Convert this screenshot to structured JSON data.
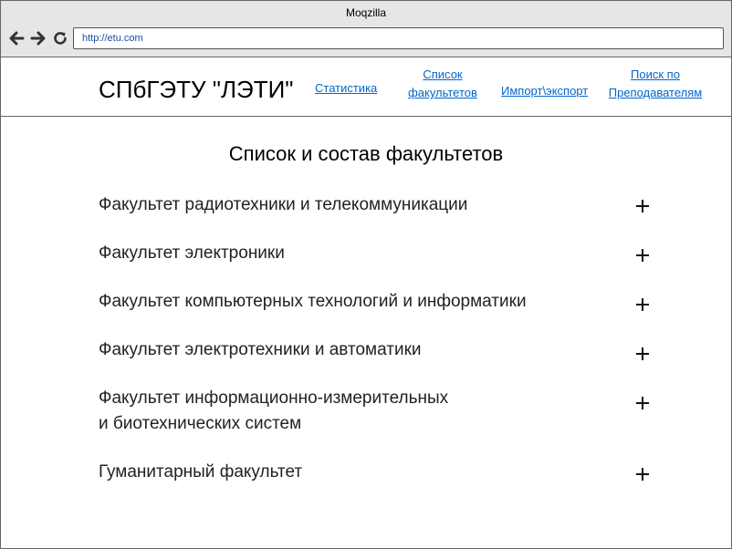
{
  "browser": {
    "window_title": "Moqzilla",
    "url": "http://etu.com",
    "back_icon": "back-arrow-icon",
    "forward_icon": "forward-arrow-icon",
    "reload_icon": "reload-icon"
  },
  "header": {
    "site_title": "СПбГЭТУ \"ЛЭТИ\"",
    "nav": [
      {
        "label": "Статистика"
      },
      {
        "label": "Список\nфакультетов"
      },
      {
        "label": "Импорт\\экспорт"
      },
      {
        "label": "Поиск по\nПреподавателям"
      }
    ]
  },
  "main": {
    "title": "Список и состав факультетов",
    "faculties": [
      {
        "label": "Факультет радиотехники и телекоммуникации",
        "icon": "plus-icon"
      },
      {
        "label": "Факультет электроники",
        "icon": "plus-icon"
      },
      {
        "label": "Факультет компьютерных технологий и информатики",
        "icon": "plus-icon"
      },
      {
        "label": "Факультет электротехники  и автоматики",
        "icon": "plus-icon"
      },
      {
        "label": "Факультет информационно-измерительных\nи биотехнических систем",
        "icon": "plus-icon"
      },
      {
        "label": "Гуманитарный факультет",
        "icon": "plus-icon"
      }
    ]
  },
  "colors": {
    "link": "#0066cc",
    "titlebar": "#e6e6e6"
  }
}
